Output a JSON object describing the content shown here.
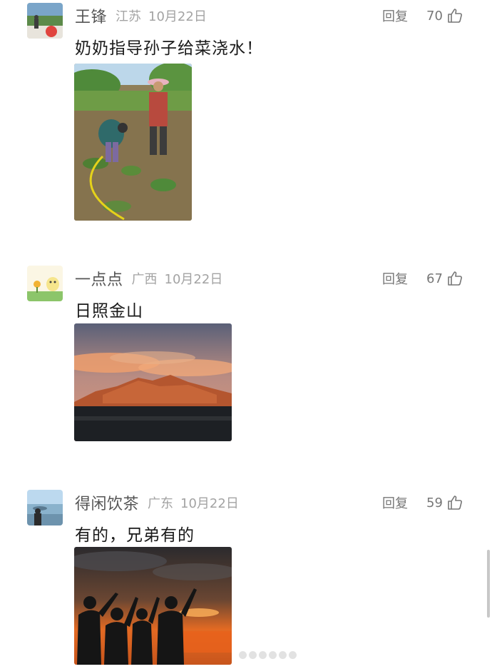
{
  "comments": [
    {
      "username": "王锋",
      "region": "江苏",
      "date": "10月22日",
      "reply_label": "回复",
      "likes": "70",
      "text": "奶奶指导孙子给菜浇水！",
      "photo_icon": "garden-watering-photo"
    },
    {
      "username": "一点点",
      "region": "广西",
      "date": "10月22日",
      "reply_label": "回复",
      "likes": "67",
      "text": "日照金山",
      "photo_icon": "golden-mountain-photo"
    },
    {
      "username": "得闲饮茶",
      "region": "广东",
      "date": "10月22日",
      "reply_label": "回复",
      "likes": "59",
      "text": "有的，兄弟有的",
      "photo_icon": "sunset-friends-photo"
    }
  ],
  "colors": {
    "name": "#555555",
    "meta": "#a3a3a3",
    "action": "#777777",
    "text": "#1a1a1a"
  },
  "icons": {
    "like": "thumbs-up-icon"
  }
}
